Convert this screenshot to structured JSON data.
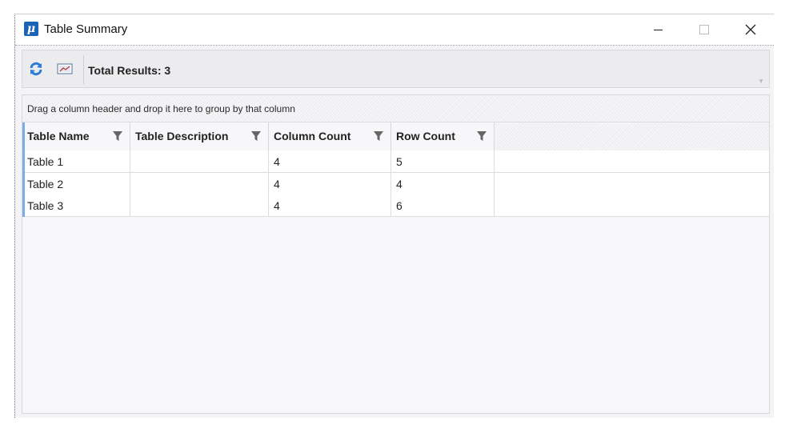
{
  "window": {
    "title": "Table Summary",
    "app_icon": "μ"
  },
  "toolbar": {
    "refresh_icon": "refresh-icon",
    "chart_icon": "chart-icon",
    "total_results": "Total Results: 3"
  },
  "grid": {
    "group_hint": "Drag a column header and drop it here to group by that column",
    "columns": [
      {
        "label": "Table Name"
      },
      {
        "label": "Table Description"
      },
      {
        "label": "Column Count"
      },
      {
        "label": "Row Count"
      }
    ],
    "rows": [
      [
        "Table 1",
        "",
        "4",
        "5"
      ],
      [
        "Table 2",
        "",
        "4",
        "4"
      ],
      [
        "Table 3",
        "",
        "4",
        "6"
      ]
    ]
  },
  "colors": {
    "accent": "#1b63b5",
    "refresh": "#2c7bd6",
    "selection_accent": "#79aee6"
  }
}
